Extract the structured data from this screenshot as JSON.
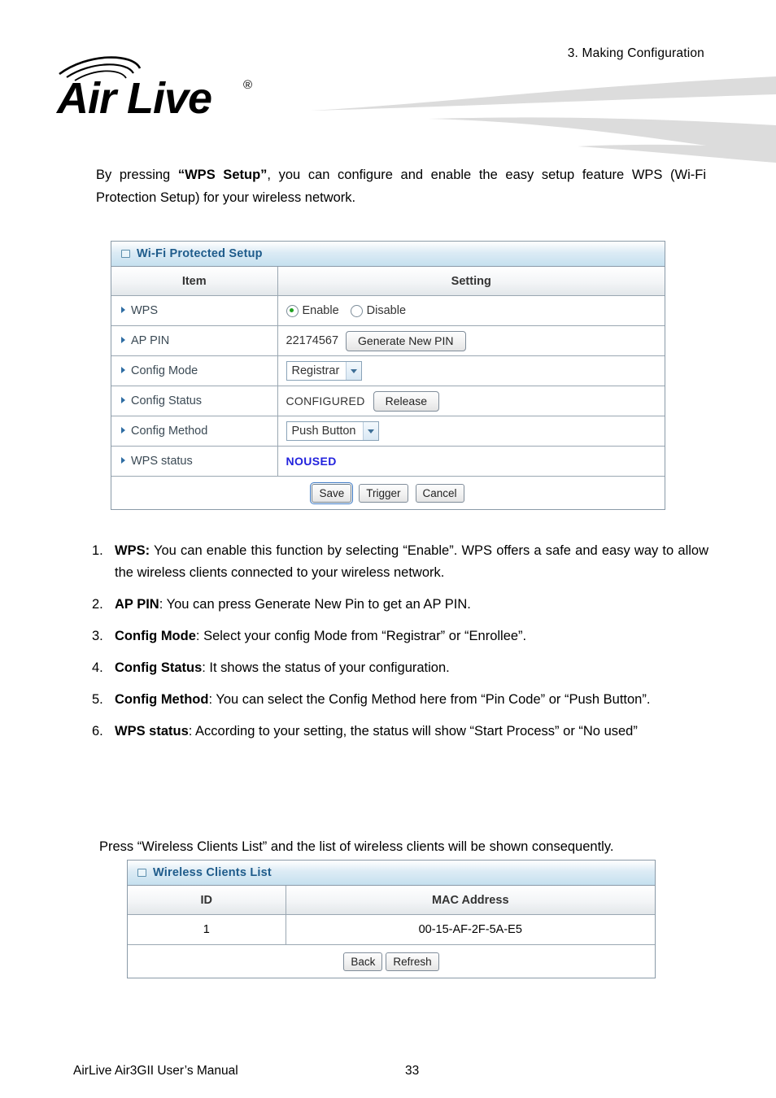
{
  "header": {
    "chapter": "3.  Making  Configuration",
    "logo_text": "Air Live",
    "logo_trademark": "®"
  },
  "intro": {
    "part1": "By pressing ",
    "bold": "“WPS Setup”",
    "part2": ", you can configure and enable the easy setup feature WPS (Wi-Fi Protection Setup) for your wireless network."
  },
  "wps_panel": {
    "title": "Wi-Fi Protected Setup",
    "columns": {
      "item": "Item",
      "setting": "Setting"
    },
    "rows": [
      {
        "item": "WPS",
        "type": "radio",
        "options": [
          {
            "label": "Enable",
            "selected": true
          },
          {
            "label": "Disable",
            "selected": false
          }
        ]
      },
      {
        "item": "AP PIN",
        "type": "value-button",
        "value": "22174567",
        "button": "Generate New PIN"
      },
      {
        "item": "Config Mode",
        "type": "select",
        "value": "Registrar",
        "options": [
          "Registrar",
          "Enrollee"
        ]
      },
      {
        "item": "Config Status",
        "type": "value-button",
        "value": "CONFIGURED",
        "button": "Release"
      },
      {
        "item": "Config Method",
        "type": "select",
        "value": "Push Button",
        "options": [
          "Pin Code",
          "Push Button"
        ]
      },
      {
        "item": "WPS status",
        "type": "status",
        "value": "NOUSED"
      }
    ],
    "actions": [
      {
        "label": "Save",
        "focused": true
      },
      {
        "label": "Trigger",
        "focused": false
      },
      {
        "label": "Cancel",
        "focused": false
      }
    ]
  },
  "notes": [
    {
      "num": "1.",
      "term": "WPS:",
      "text": " You can enable this function by selecting “Enable”. WPS offers a safe and easy way to allow the wireless clients connected to your wireless network."
    },
    {
      "num": "2.",
      "term": "AP PIN",
      "text": ": You can press Generate New Pin to get an AP PIN."
    },
    {
      "num": "3.",
      "term": "Config Mode",
      "text": ": Select your config Mode from “Registrar” or “Enrollee”."
    },
    {
      "num": "4.",
      "term": "Config Status",
      "text": ": It shows the status of your configuration."
    },
    {
      "num": "5.",
      "term": "Config Method",
      "text": ": You can select the Config Method here from “Pin Code” or “Push Button”."
    },
    {
      "num": "6.",
      "term": "WPS status",
      "text": ": According to your setting, the status will show “Start Process” or “No used”"
    }
  ],
  "press_line": "Press “Wireless Clients List” and the list of wireless clients will be shown consequently.",
  "clients_panel": {
    "title": "Wireless Clients List",
    "columns": {
      "id": "ID",
      "mac": "MAC Address"
    },
    "rows": [
      {
        "id": "1",
        "mac": "00-15-AF-2F-5A-E5"
      }
    ],
    "actions": [
      {
        "label": "Back"
      },
      {
        "label": "Refresh"
      }
    ]
  },
  "footer": {
    "manual": "AirLive Air3GII User’s Manual",
    "page": "33"
  },
  "colors": {
    "panel_title_text": "#1f5c8b",
    "status_text": "#2222dd",
    "radio_dot": "#21a121",
    "bullet": "#2f6da3",
    "swoosh": "#dcdcdc"
  }
}
